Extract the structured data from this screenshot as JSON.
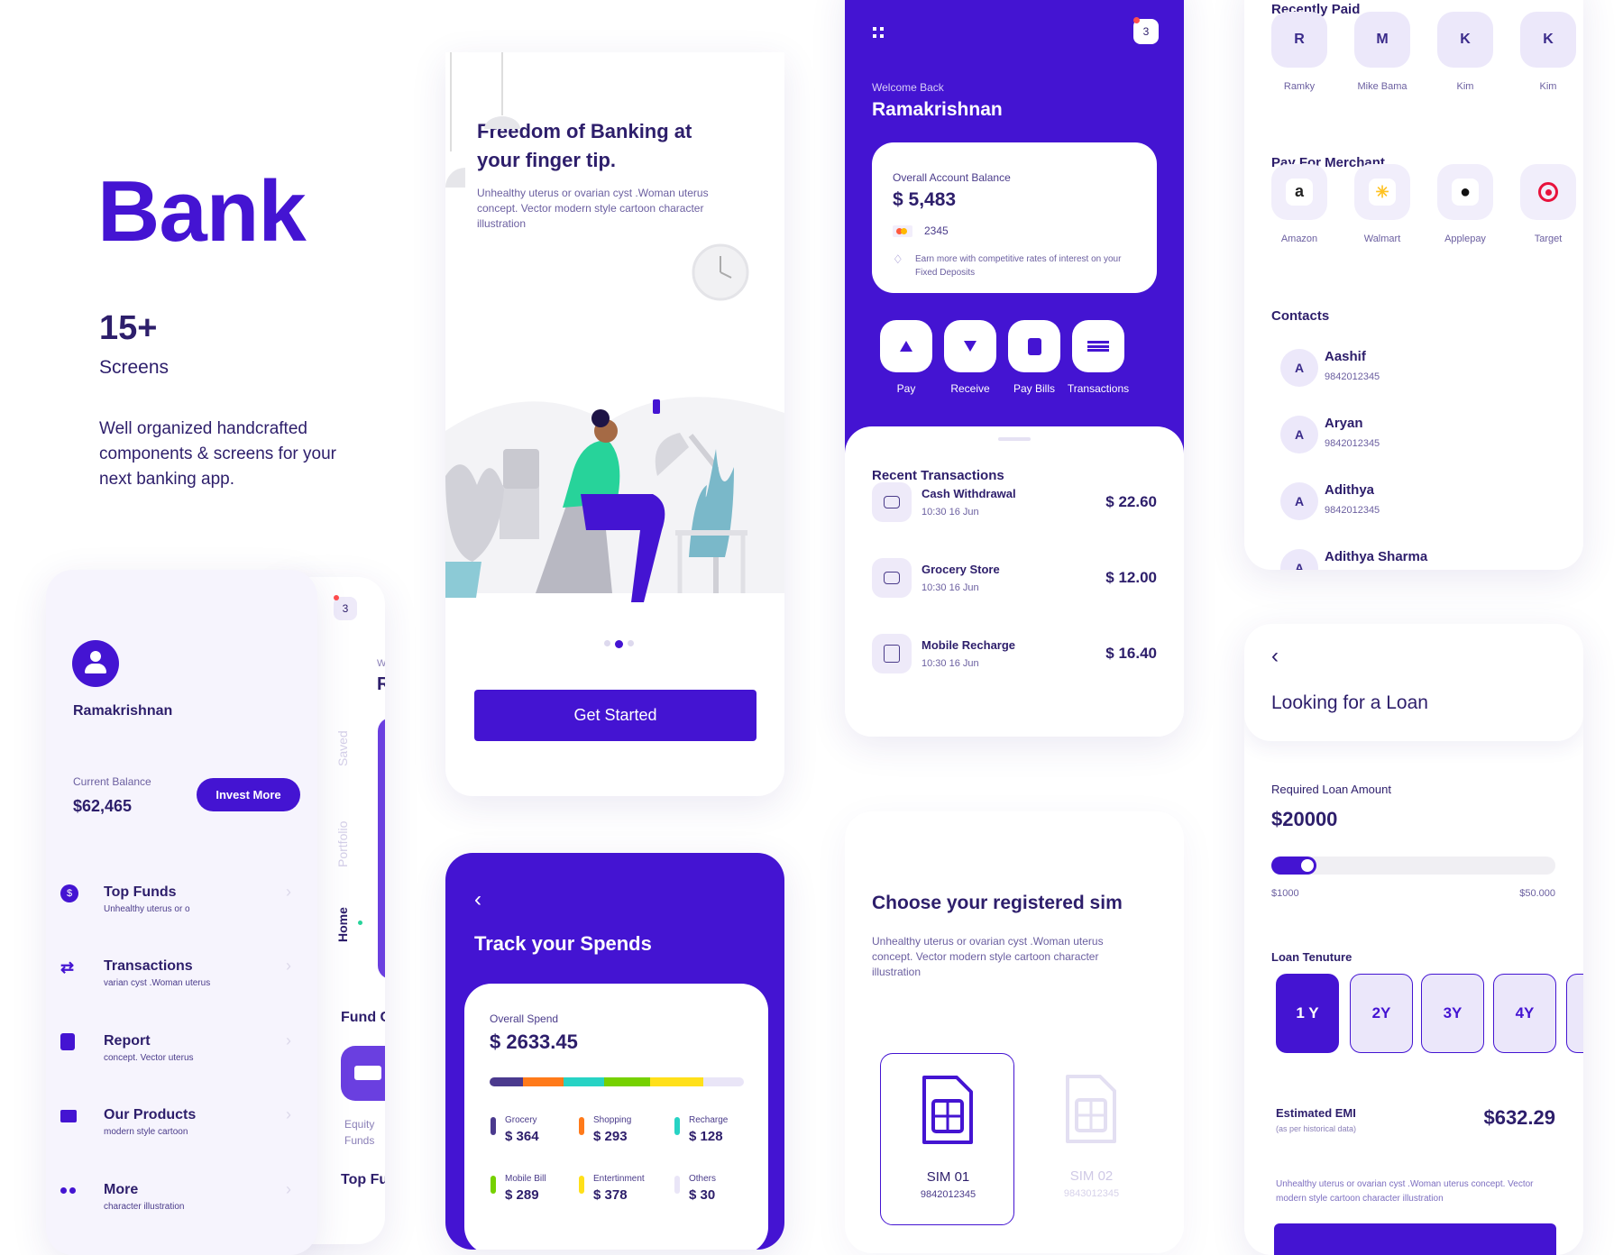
{
  "intro": {
    "title": "Bank",
    "count": "15+",
    "count_label": "Screens",
    "description": "Well organized handcrafted components & screens for your next banking app."
  },
  "colors": {
    "primary": "#4414d2",
    "text": "#2d1e6b",
    "soft": "#f6f4fd"
  },
  "profile": {
    "name": "Ramakrishnan",
    "balance_label": "Current Balance",
    "balance": "$62,465",
    "invest_button": "Invest More",
    "menu": [
      {
        "icon": "dollar-circle-icon",
        "title": "Top Funds",
        "subtitle": "Unhealthy uterus or o"
      },
      {
        "icon": "swap-arrows-icon",
        "title": "Transactions",
        "subtitle": "varian cyst .Woman uterus"
      },
      {
        "icon": "document-icon",
        "title": "Report",
        "subtitle": "concept. Vector uterus"
      },
      {
        "icon": "box-icon",
        "title": "Our Products",
        "subtitle": "modern style cartoon"
      },
      {
        "icon": "more-dots-icon",
        "title": "More",
        "subtitle": "character illustration"
      }
    ]
  },
  "home_peek": {
    "badge": "3",
    "welcome": "W",
    "name": "R",
    "tabs": [
      "Saved",
      "Portfolio",
      "Home"
    ],
    "fund_heading": "Fund C",
    "fund_item": "Equity Funds",
    "top_heading": "Top Fu"
  },
  "onboarding": {
    "title": "Freedom of Banking at your finger tip.",
    "description": "Unhealthy uterus or ovarian cyst .Woman uterus concept. Vector modern style cartoon character illustration",
    "page_index": 2,
    "page_count": 3,
    "button": "Get Started"
  },
  "spends": {
    "title": "Track your Spends",
    "overall_label": "Overall Spend",
    "overall": "$ 2633.45",
    "categories": [
      {
        "label": "Grocery",
        "value": "$ 364",
        "color": "#4b3a8e",
        "bar_percent": 13
      },
      {
        "label": "Shopping",
        "value": "$ 293",
        "color": "#ff7a1a",
        "bar_percent": 16
      },
      {
        "label": "Recharge",
        "value": "$ 128",
        "color": "#27d3c4",
        "bar_percent": 16
      },
      {
        "label": "Mobile Bill",
        "value": "$ 289",
        "color": "#76d100",
        "bar_percent": 18
      },
      {
        "label": "Entertinment",
        "value": "$ 378",
        "color": "#ffe01a",
        "bar_percent": 21
      },
      {
        "label": "Others",
        "value": "$ 30",
        "color": "#e9e5f7",
        "bar_percent": 16
      }
    ]
  },
  "dashboard": {
    "notifications": "3",
    "welcome": "Welcome Back",
    "name": "Ramakrishnan",
    "balance_label": "Overall Account Balance",
    "balance": "$ 5,483",
    "card_last4": "2345",
    "tip": "Earn more with competitive rates of interest on your Fixed Deposits",
    "actions": [
      {
        "icon": "arrow-up-icon",
        "label": "Pay"
      },
      {
        "icon": "arrow-down-icon",
        "label": "Receive"
      },
      {
        "icon": "bill-icon",
        "label": "Pay Bills"
      },
      {
        "icon": "list-icon",
        "label": "Transactions"
      }
    ],
    "recent_title": "Recent Transactions",
    "transactions": [
      {
        "icon": "cash-icon",
        "name": "Cash Withdrawal",
        "time": "10:30 16 Jun",
        "amount": "$ 22.60"
      },
      {
        "icon": "shopping-bag-icon",
        "name": "Grocery Store",
        "time": "10:30 16 Jun",
        "amount": "$ 12.00"
      },
      {
        "icon": "phone-icon",
        "name": "Mobile Recharge",
        "time": "10:30 16 Jun",
        "amount": "$ 16.40"
      }
    ]
  },
  "sim": {
    "title": "Choose your registered sim",
    "description": "Unhealthy uterus or ovarian cyst .Woman uterus concept. Vector modern style cartoon character illustration",
    "options": [
      {
        "label": "SIM 01",
        "number": "9842012345",
        "selected": true
      },
      {
        "label": "SIM 02",
        "number": "9843012345",
        "selected": false
      }
    ]
  },
  "payments": {
    "recent_title": "Recently Paid",
    "recent": [
      {
        "initial": "R",
        "name": "Ramky"
      },
      {
        "initial": "M",
        "name": "Mike Bama"
      },
      {
        "initial": "K",
        "name": "Kim"
      },
      {
        "initial": "K",
        "name": "Kim"
      }
    ],
    "merchant_title": "Pay For Merchant",
    "merchants": [
      {
        "icon": "amazon-icon",
        "name": "Amazon"
      },
      {
        "icon": "walmart-icon",
        "name": "Walmart"
      },
      {
        "icon": "apple-icon",
        "name": "Applepay"
      },
      {
        "icon": "target-icon",
        "name": "Target"
      }
    ],
    "contacts_title": "Contacts",
    "contacts": [
      {
        "initial": "A",
        "name": "Aashif",
        "number": "9842012345"
      },
      {
        "initial": "A",
        "name": "Aryan",
        "number": "9842012345"
      },
      {
        "initial": "A",
        "name": "Adithya",
        "number": "9842012345"
      },
      {
        "initial": "A",
        "name": "Adithya Sharma",
        "number": ""
      }
    ]
  },
  "loan": {
    "title": "Looking for a Loan",
    "amount_label": "Required Loan Amount",
    "amount": "$20000",
    "slider_min": "$1000",
    "slider_max": "$50.000",
    "slider_fill_percent": 16,
    "tenure_label": "Loan Tenuture",
    "tenures": [
      "1 Y",
      "2Y",
      "3Y",
      "4Y",
      ""
    ],
    "selected_tenure": "1 Y",
    "emi_label": "Estimated EMI",
    "emi_note": "(as per historical data)",
    "emi": "$632.29",
    "description": "Unhealthy uterus or ovarian cyst .Woman uterus concept. Vector modern style cartoon character illustration"
  }
}
